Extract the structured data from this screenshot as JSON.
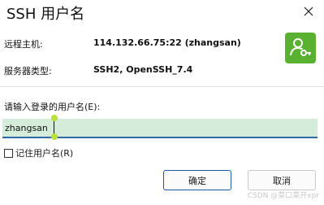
{
  "window": {
    "title": "SSH 用户名",
    "close_icon": "close-icon"
  },
  "info": {
    "remote_host_label": "远程主机:",
    "remote_host_value": "114.132.66.75:22 (zhangsan)",
    "server_type_label": "服务器类型:",
    "server_type_value": "SSH2, OpenSSH_7.4",
    "badge_icon": "user-key-icon",
    "badge_color": "#5ab030"
  },
  "form": {
    "prompt_label": "请输入登录的用户名(E):",
    "username_value": "zhangsan",
    "remember_label": "记住用户名(R)",
    "remember_checked": false
  },
  "buttons": {
    "ok_label": "确定",
    "cancel_label": "取消"
  },
  "watermark": "CSDN @菜口菜开xpr",
  "colors": {
    "input_bg": "#d4ecd9",
    "input_underline": "#2e6aa6",
    "ok_border": "#1c5aa6"
  }
}
